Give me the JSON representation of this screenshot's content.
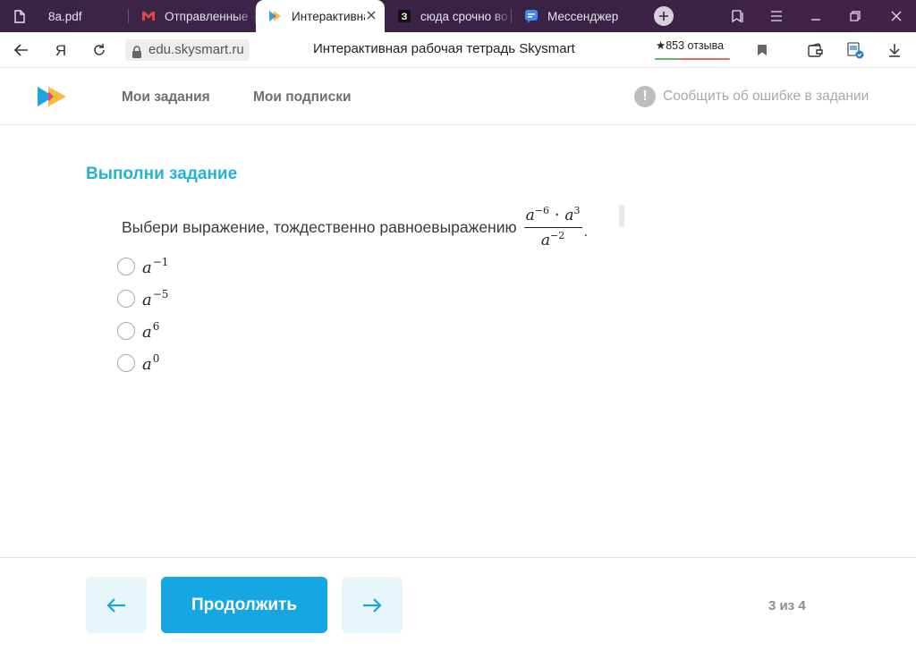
{
  "browser": {
    "tabs": [
      {
        "label": "8a.pdf",
        "icon": "file-icon",
        "active": false
      },
      {
        "label": "Отправленные - ",
        "icon": "gmail-icon",
        "active": false
      },
      {
        "label": "Интерактивна",
        "icon": "skysmart-play-icon",
        "active": true
      },
      {
        "label": "сюда срочно во",
        "icon": "znanija-icon",
        "active": false
      },
      {
        "label": "Мессенджер",
        "icon": "messenger-icon",
        "active": false
      }
    ],
    "url": "edu.skysmart.ru",
    "page_title": "Интерактивная рабочая тетрадь Skysmart",
    "rating_text": "★853 отзыва"
  },
  "site": {
    "nav": {
      "my_tasks": "Мои задания",
      "my_subscriptions": "Мои подписки"
    },
    "report_error": "Сообщить об ошибке в задании"
  },
  "task": {
    "heading": "Выполни задание",
    "question_text": "Выбери выражение, тождественно равноевыражению",
    "expression": {
      "numerator": [
        {
          "base": "a",
          "exp": "−6"
        },
        {
          "base": "a",
          "exp": "3"
        }
      ],
      "denominator": {
        "base": "a",
        "exp": "−2"
      },
      "period": "."
    },
    "options": [
      {
        "base": "a",
        "exp": "−1"
      },
      {
        "base": "a",
        "exp": "−5"
      },
      {
        "base": "a",
        "exp": "6"
      },
      {
        "base": "a",
        "exp": "0"
      }
    ]
  },
  "footer": {
    "continue_label": "Продолжить",
    "page_counter": "3 из 4"
  },
  "colors": {
    "accent": "#16a7e2",
    "heading": "#25b2d7",
    "tab_strip": "#3c2347"
  }
}
